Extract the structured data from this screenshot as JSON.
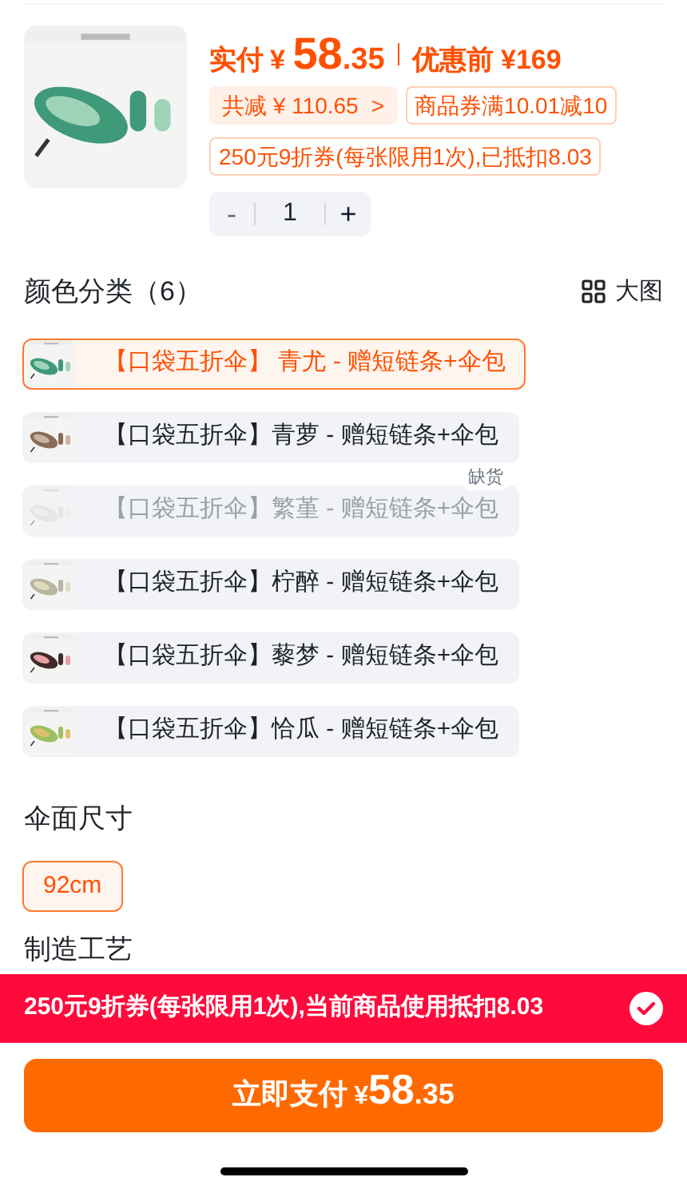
{
  "product": {
    "price_label": "实付",
    "currency": "¥",
    "price_int": "58",
    "price_dec": ".35",
    "original_price": "优惠前 ¥169",
    "discount_chip": "共减 ¥ 110.65",
    "discount_arrow": ">",
    "coupon_chip": "商品券满10.01减10",
    "coupon_used": "250元9折券(每张限用1次),已抵扣8.03",
    "quantity": {
      "minus": "-",
      "value": "1",
      "plus": "+",
      "minus_disabled": true
    }
  },
  "color_section": {
    "title": "颜色分类（6）",
    "view_toggle": "大图",
    "options": [
      {
        "label": "【口袋五折伞】 青尤 - 赠短链条+伞包",
        "selected": true,
        "disabled": false
      },
      {
        "label": "【口袋五折伞】青萝 - 赠短链条+伞包",
        "selected": false,
        "disabled": false
      },
      {
        "label": "【口袋五折伞】繁堇 - 赠短链条+伞包",
        "selected": false,
        "disabled": true,
        "badge": "缺货"
      },
      {
        "label": "【口袋五折伞】柠醉 - 赠短链条+伞包",
        "selected": false,
        "disabled": false
      },
      {
        "label": "【口袋五折伞】藜梦 - 赠短链条+伞包",
        "selected": false,
        "disabled": false
      },
      {
        "label": "【口袋五折伞】恰瓜 - 赠短链条+伞包",
        "selected": false,
        "disabled": false
      }
    ]
  },
  "size_section": {
    "title": "伞面尺寸",
    "options": [
      {
        "label": "92cm",
        "selected": true
      }
    ]
  },
  "craft_section": {
    "title": "制造工艺"
  },
  "coupon_banner": {
    "text": "250元9折券(每张限用1次),当前商品使用抵扣8.03",
    "checked": true
  },
  "pay_button": {
    "label": "立即支付",
    "currency": "¥",
    "price_int": "58",
    "price_dec": ".35"
  }
}
